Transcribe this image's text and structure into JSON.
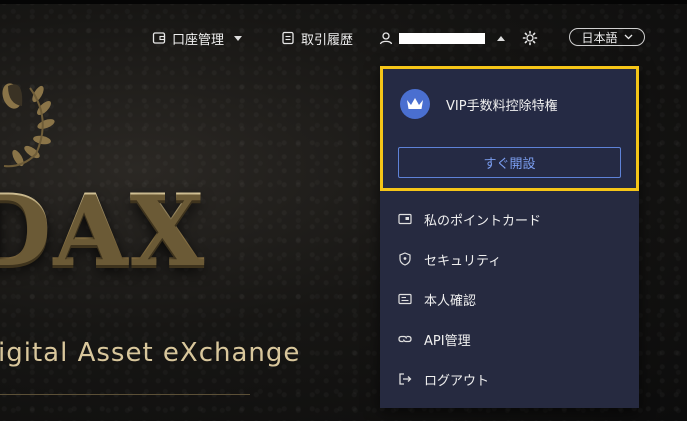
{
  "header": {
    "account_label": "口座管理",
    "history_label": "取引履歴",
    "language_label": "日本語"
  },
  "hero": {
    "title": "DAX",
    "subtitle": "igital Asset eXchange"
  },
  "dropdown": {
    "vip": {
      "text": "VIP手数料控除特権",
      "button_label": "すぐ開設"
    },
    "items": [
      {
        "label": "私のポイントカード",
        "icon": "card-icon"
      },
      {
        "label": "セキュリティ",
        "icon": "shield-icon"
      },
      {
        "label": "本人確認",
        "icon": "id-card-icon"
      },
      {
        "label": "API管理",
        "icon": "link-icon"
      },
      {
        "label": "ログアウト",
        "icon": "logout-icon"
      }
    ]
  },
  "colors": {
    "highlight_border": "#f5c518",
    "menu_bg": "#262a40",
    "accent_blue": "#5e82d8"
  }
}
